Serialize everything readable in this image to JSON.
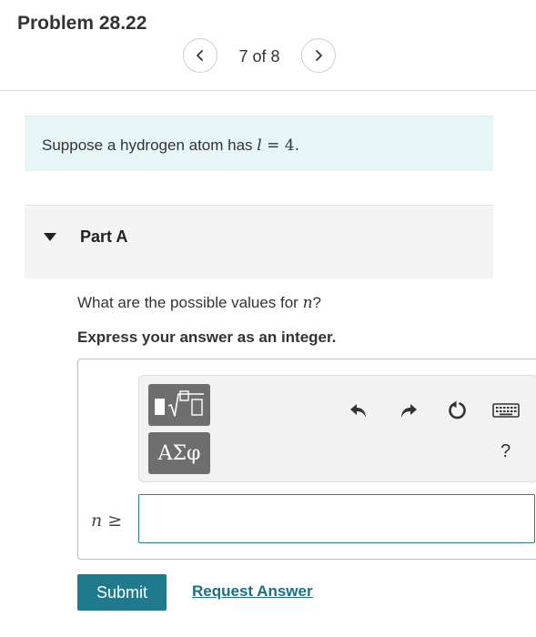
{
  "header": {
    "title": "Problem 28.22",
    "position": "7 of 8"
  },
  "intro": {
    "prefix": "Suppose a hydrogen atom has ",
    "var": "l",
    "equals": " = ",
    "value": "4",
    "suffix": "."
  },
  "part": {
    "title": "Part A",
    "question_prefix": "What are the possible values for ",
    "question_var": "n",
    "question_suffix": "?",
    "instruction": "Express your answer as an integer."
  },
  "toolbar": {
    "symbols_label": "ΑΣφ",
    "help_label": "?"
  },
  "answer": {
    "label_var": "n",
    "label_op": " ≥",
    "value": ""
  },
  "actions": {
    "submit_label": "Submit",
    "request_label": "Request Answer"
  },
  "colors": {
    "accent": "#1e7a8c",
    "intro_bg": "#e8f5f6",
    "part_bg": "#f4f4f4",
    "tool_bg": "#6e6e6e"
  },
  "icons": [
    "chevron-left-icon",
    "chevron-right-icon",
    "caret-down-icon",
    "templates-icon",
    "undo-icon",
    "redo-icon",
    "reset-icon",
    "keyboard-icon"
  ]
}
